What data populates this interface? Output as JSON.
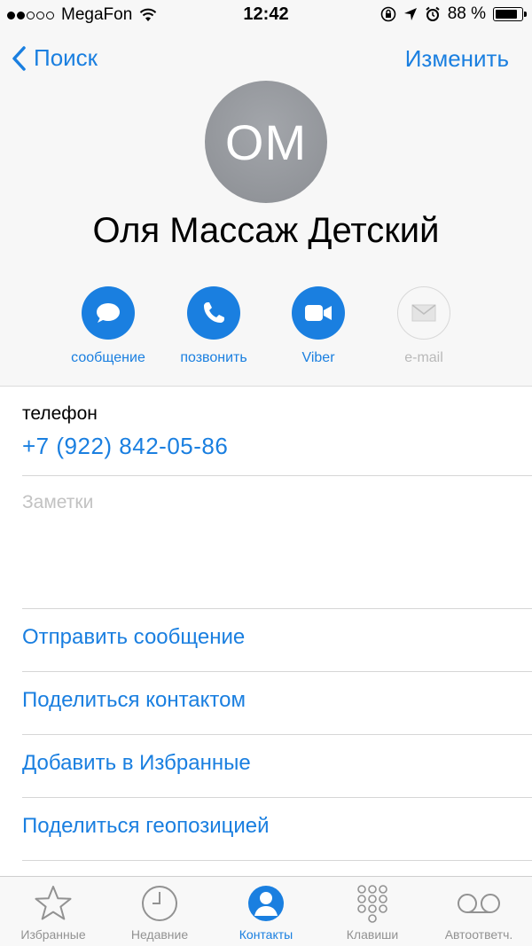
{
  "status_bar": {
    "carrier": "MegaFon",
    "signal_dots_filled": 2,
    "signal_dots_total": 5,
    "time": "12:42",
    "battery_percent": "88 %",
    "battery_level": 0.88
  },
  "nav": {
    "back_label": "Поиск",
    "edit_label": "Изменить"
  },
  "contact": {
    "initials": "ОМ",
    "name": "Оля Массаж Детский"
  },
  "actions": [
    {
      "label": "сообщение",
      "icon": "message-icon",
      "enabled": true
    },
    {
      "label": "позвонить",
      "icon": "phone-icon",
      "enabled": true
    },
    {
      "label": "Viber",
      "icon": "video-icon",
      "enabled": true
    },
    {
      "label": "e-mail",
      "icon": "mail-icon",
      "enabled": false
    }
  ],
  "phone": {
    "label": "телефон",
    "number": "+7 (922) 842-05-86"
  },
  "notes": {
    "placeholder": "Заметки"
  },
  "links": [
    "Отправить сообщение",
    "Поделиться контактом",
    "Добавить в Избранные",
    "Поделиться геопозицией"
  ],
  "tabs": [
    {
      "label": "Избранные",
      "icon": "star-icon",
      "active": false
    },
    {
      "label": "Недавние",
      "icon": "clock-icon",
      "active": false
    },
    {
      "label": "Контакты",
      "icon": "contacts-icon",
      "active": true
    },
    {
      "label": "Клавиши",
      "icon": "keypad-icon",
      "active": false
    },
    {
      "label": "Автоответч.",
      "icon": "voicemail-icon",
      "active": false
    }
  ],
  "colors": {
    "accent": "#1a7fe0",
    "inactive": "#929292",
    "disabled": "#b9b9b9"
  }
}
